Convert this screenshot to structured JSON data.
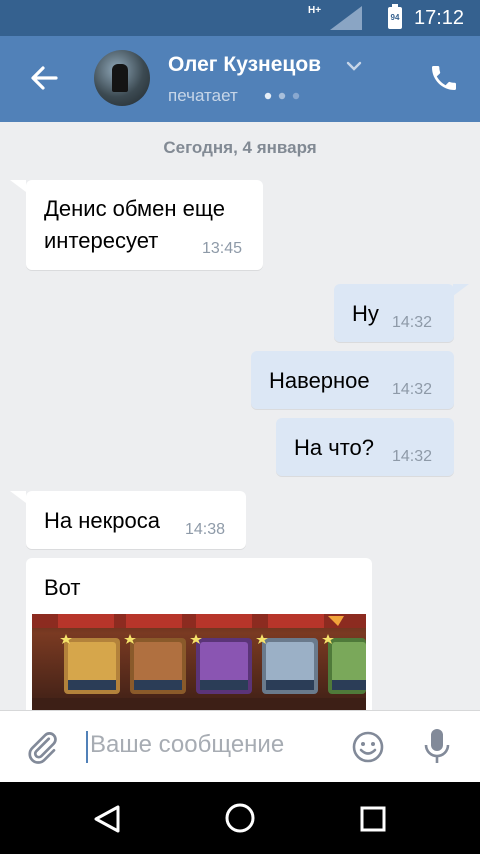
{
  "status_bar": {
    "network_type": "H+",
    "battery_level": "94",
    "time": "17:12"
  },
  "header": {
    "contact_name": "Олег Кузнецов",
    "status": "печатает",
    "icons": [
      "back-arrow-icon",
      "chevron-down-icon",
      "typing-dots-icon",
      "phone-icon"
    ]
  },
  "chat": {
    "date_separator": "Сегодня, 4 января",
    "messages": [
      {
        "direction": "in",
        "text_line1": "Денис обмен еще",
        "text_line2": "интересует",
        "time": "13:45"
      },
      {
        "direction": "out",
        "text": "Ну",
        "time": "14:32"
      },
      {
        "direction": "out",
        "text": "Наверное",
        "time": "14:32"
      },
      {
        "direction": "out",
        "text": "На что?",
        "time": "14:32"
      },
      {
        "direction": "in",
        "text": "На некроса",
        "time": "14:38"
      },
      {
        "direction": "in",
        "text": "Вот",
        "attachment": "game-screenshot-image"
      }
    ]
  },
  "input": {
    "placeholder": "Ваше сообщение",
    "icons": [
      "attach-icon",
      "emoji-icon",
      "microphone-icon"
    ]
  },
  "nav_bar": {
    "icons": [
      "nav-back-icon",
      "nav-home-icon",
      "nav-recents-icon"
    ]
  },
  "colors": {
    "header": "#5181b8",
    "status_bar": "#35618f",
    "chat_background": "#edeef0",
    "incoming_bubble": "#ffffff",
    "outgoing_bubble": "#dce7f5"
  }
}
